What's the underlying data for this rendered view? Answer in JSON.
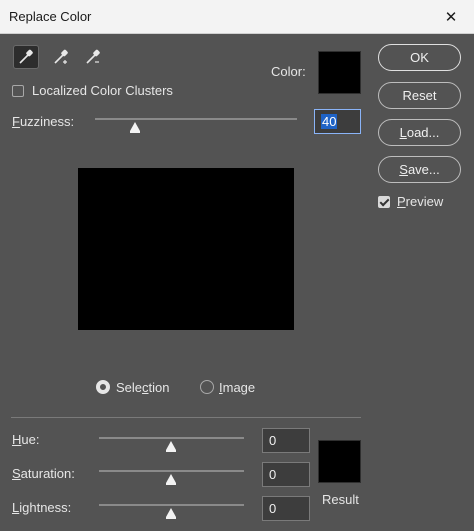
{
  "window": {
    "title": "Replace Color",
    "close_glyph": "✕"
  },
  "tools": [
    {
      "icon": "eyedropper-icon",
      "active": true
    },
    {
      "icon": "eyedropper-plus-icon",
      "active": false
    },
    {
      "icon": "eyedropper-minus-icon",
      "active": false
    }
  ],
  "color_label": "Color:",
  "localized_clusters": {
    "label": "Localized Color Clusters",
    "checked": false
  },
  "fuzziness": {
    "label": "Fuzziness:",
    "value": "40",
    "slider_fraction": 0.2
  },
  "view": {
    "selection_label": "Selection",
    "image_label": "Image",
    "selected": "selection"
  },
  "hue": {
    "label": "Hue:",
    "value": "0"
  },
  "saturation": {
    "label": "Saturation:",
    "value": "0"
  },
  "lightness": {
    "label": "Lightness:",
    "value": "0"
  },
  "result_label": "Result",
  "buttons": {
    "ok": "OK",
    "reset": "Reset",
    "load": "Load...",
    "save": "Save..."
  },
  "preview": {
    "label": "Preview",
    "checked": true
  },
  "colors": {
    "panel": "#535353",
    "swatch": "#000000",
    "selection_highlight": "#1f63c6"
  }
}
